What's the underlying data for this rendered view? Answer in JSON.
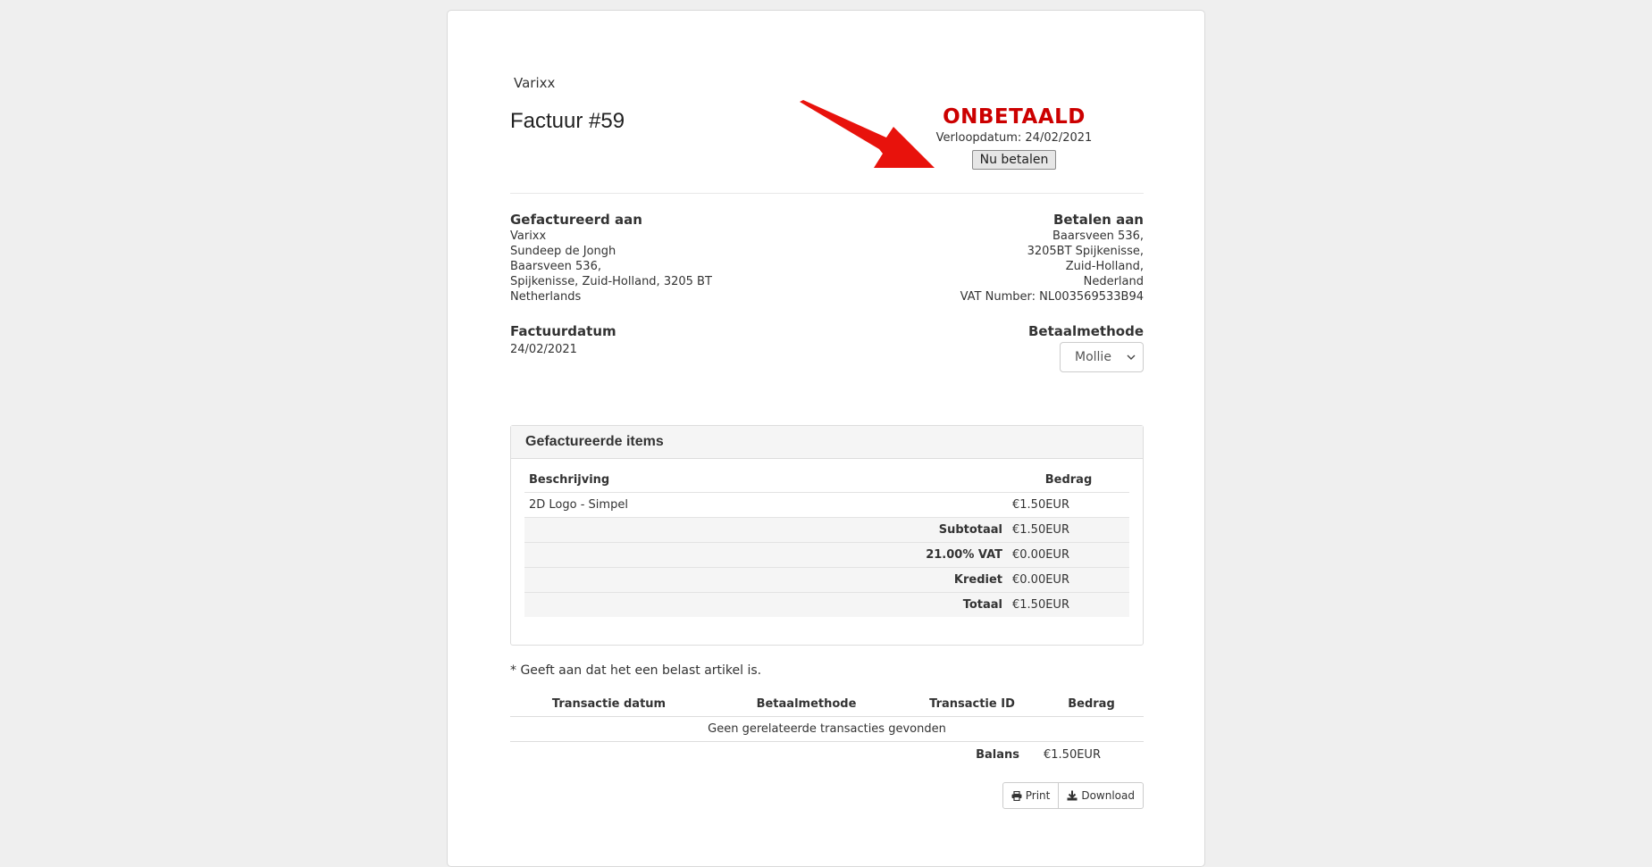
{
  "invoice": {
    "logo_alt": "Varixx",
    "title": "Factuur #59",
    "status": "ONBETAALD",
    "due_label": "Verloopdatum: 24/02/2021",
    "pay_button": "Nu betalen"
  },
  "billed_to": {
    "heading": "Gefactureerd aan",
    "lines": [
      "Varixx",
      "Sundeep de Jongh",
      "Baarsveen 536,",
      "Spijkenisse, Zuid-Holland, 3205 BT",
      "Netherlands"
    ]
  },
  "pay_to": {
    "heading": "Betalen aan",
    "lines": [
      "Baarsveen 536,",
      "3205BT Spijkenisse,",
      "Zuid-Holland,",
      "Nederland",
      "VAT Number: NL003569533B94"
    ]
  },
  "invoice_date": {
    "heading": "Factuurdatum",
    "value": "24/02/2021"
  },
  "payment_method": {
    "heading": "Betaalmethode",
    "selected": "Mollie"
  },
  "items_panel": {
    "title": "Gefactureerde items",
    "col_description": "Beschrijving",
    "col_amount": "Bedrag",
    "rows": [
      {
        "description": "2D Logo - Simpel",
        "amount": "€1.50EUR"
      }
    ],
    "totals": [
      {
        "label": "Subtotaal",
        "amount": "€1.50EUR"
      },
      {
        "label": "21.00% VAT",
        "amount": "€0.00EUR"
      },
      {
        "label": "Krediet",
        "amount": "€0.00EUR"
      },
      {
        "label": "Totaal",
        "amount": "€1.50EUR"
      }
    ]
  },
  "taxed_note": "* Geeft aan dat het een belast artikel is.",
  "transactions": {
    "col_date": "Transactie datum",
    "col_method": "Betaalmethode",
    "col_id": "Transactie ID",
    "col_amount": "Bedrag",
    "empty": "Geen gerelateerde transacties gevonden",
    "balance_label": "Balans",
    "balance_value": "€1.50EUR"
  },
  "actions": {
    "print": "Print",
    "download": "Download"
  },
  "colors": {
    "unpaid": "#cc0000",
    "arrow": "#e8120c"
  }
}
